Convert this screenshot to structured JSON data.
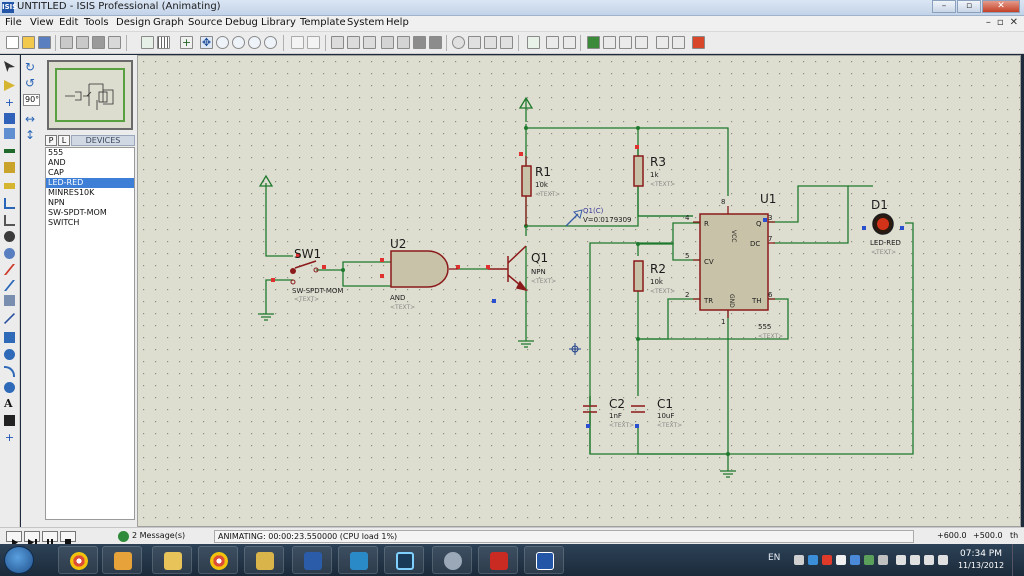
{
  "window": {
    "app_icon_text": "ISIS",
    "title": "UNTITLED - ISIS Professional (Animating)",
    "minimize_glyph": "–",
    "restore_glyph": "▫",
    "close_glyph": "✕"
  },
  "menu": {
    "items": [
      "File",
      "View",
      "Edit",
      "Tools",
      "Design",
      "Graph",
      "Source",
      "Debug",
      "Library",
      "Template",
      "System",
      "Help"
    ],
    "mdi_controls": [
      "–",
      "▫",
      "✕"
    ]
  },
  "toolbar": {
    "icons": [
      "new-icon",
      "open-icon",
      "save-icon",
      "import-icon",
      "export-icon",
      "print-icon",
      "area-icon",
      "refresh-icon",
      "grid-icon",
      "origin-icon",
      "pan-icon",
      "zoom-in-icon",
      "zoom-out-icon",
      "zoom-all-icon",
      "zoom-area-icon",
      "undo-icon",
      "redo-icon",
      "cut-icon",
      "copy-icon",
      "paste-icon",
      "block-copy-icon",
      "block-move-icon",
      "block-rotate-icon",
      "block-delete-icon",
      "pick-icon",
      "make-device-icon",
      "packaging-icon",
      "decompose-icon",
      "wire-autorouter-icon",
      "search-icon",
      "property-tool-icon",
      "design-explorer-icon",
      "new-sheet-icon",
      "remove-sheet-icon",
      "goto-sheet-icon",
      "netlist-icon",
      "bom-icon",
      "ares-icon"
    ]
  },
  "left_tools": {
    "icons": [
      "select-icon",
      "component-icon",
      "junction-icon",
      "wire-label-icon",
      "text-script-icon",
      "bus-icon",
      "subcircuit-icon",
      "terminal-icon",
      "pin-icon",
      "graph-icon",
      "tape-icon",
      "generator-icon",
      "probe-voltage-icon",
      "probe-current-icon",
      "instrument-icon",
      "line-icon",
      "box-icon",
      "circle-icon",
      "arc-icon",
      "path-icon",
      "text-icon",
      "symbol-icon",
      "marker-icon"
    ]
  },
  "side_panel": {
    "rotation_value": "90°",
    "pick_button": "P",
    "library_button": "L",
    "devices_header": "DEVICES",
    "devices": [
      "555",
      "AND",
      "CAP",
      "LED-RED",
      "MINRES10K",
      "NPN",
      "SW-SPDT-MOM",
      "SWITCH"
    ],
    "selected_device": "LED-RED"
  },
  "schematic": {
    "sw1_ref": "SW1",
    "sw1_value": "SW-SPDT-MOM",
    "sw1_text": "<TEXT>",
    "u2_ref": "U2",
    "u2_value": "AND",
    "u2_text": "<TEXT>",
    "q1_ref": "Q1",
    "q1_value": "NPN",
    "q1_text": "<TEXT>",
    "r1_ref": "R1",
    "r1_value": "10k",
    "r1_text": "<TEXT>",
    "r3_ref": "R3",
    "r3_value": "1k",
    "r3_text": "<TEXT>",
    "r2_ref": "R2",
    "r2_value": "10k",
    "r2_text": "<TEXT>",
    "u1_ref": "U1",
    "u1_value": "555",
    "u1_text": "<TEXT>",
    "u1_pins": {
      "r": "R",
      "vcc": "VCC",
      "q": "Q",
      "dc": "DC",
      "cv": "CV",
      "tr": "TR",
      "gnd": "GND",
      "th": "TH"
    },
    "u1_pin_numbers": {
      "p4": "4",
      "p8": "8",
      "p3": "3",
      "p7": "7",
      "p5": "5",
      "p2": "2",
      "p6": "6",
      "p1": "1"
    },
    "d1_ref": "D1",
    "d1_value": "LED-RED",
    "d1_text": "<TEXT>",
    "c2_ref": "C2",
    "c2_value": "1nF",
    "c2_text": "<TEXT>",
    "c1_ref": "C1",
    "c1_value": "10uF",
    "c1_text": "<TEXT>",
    "probe_name": "Q1(C)",
    "probe_reading": "V=0.0179309",
    "colors": {
      "wire": "#1f7a2e",
      "component": "#8b1a1a",
      "body_fill": "#c8c2a8",
      "text_dark": "#1c1c1c",
      "text_gray": "#8a8a8a",
      "pin_high": "#e03030",
      "pin_low": "#2a4fd0",
      "led_on": "#d23318",
      "canvas": "#ddddd0"
    }
  },
  "status": {
    "messages": "2 Message(s)",
    "animating": "ANIMATING: 00:00:23.550000 (CPU load 1%)",
    "x_coord": "+600.0",
    "y_coord": "+500.0",
    "units": "th"
  },
  "taskbar": {
    "language": "EN",
    "time": "07:34 PM",
    "date": "11/13/2012",
    "apps": [
      "chrome-icon",
      "explorer-icon",
      "media-icon",
      "word-icon",
      "ares-icon",
      "isis-icon",
      "paint-icon",
      "acrobat-icon",
      "proteus-icon"
    ]
  }
}
